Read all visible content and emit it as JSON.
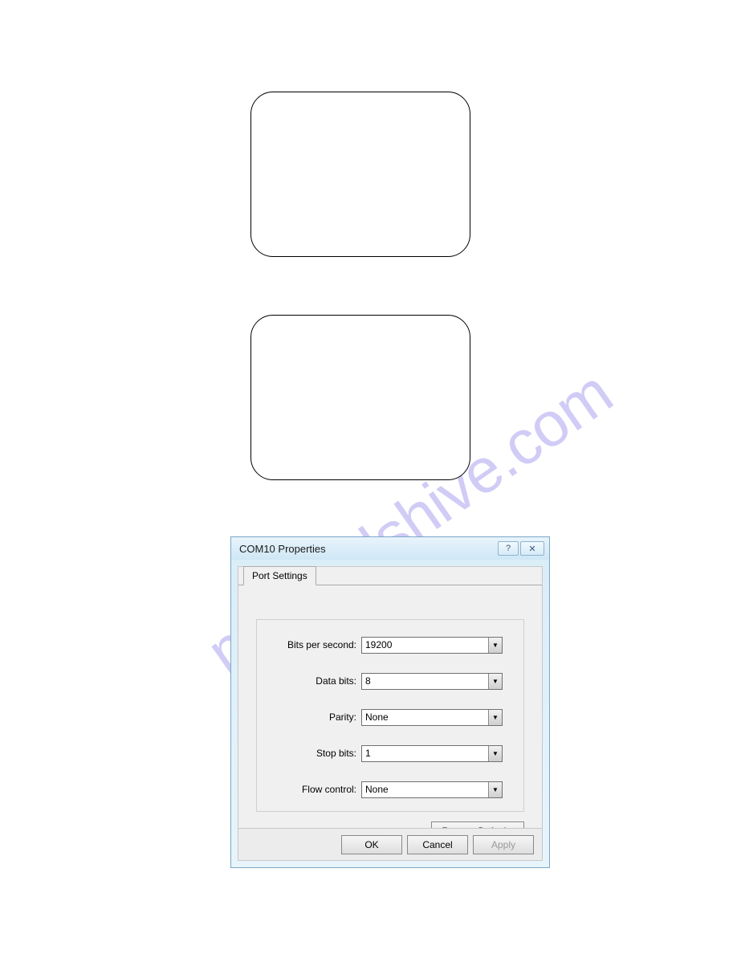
{
  "watermark": "manualshive.com",
  "dialog": {
    "title": "COM10 Properties",
    "tab_label": "Port Settings",
    "fields": {
      "bits_per_second": {
        "label": "Bits per second:",
        "value": "19200"
      },
      "data_bits": {
        "label": "Data bits:",
        "value": "8"
      },
      "parity": {
        "label": "Parity:",
        "value": "None"
      },
      "stop_bits": {
        "label": "Stop bits:",
        "value": "1"
      },
      "flow_control": {
        "label": "Flow control:",
        "value": "None"
      }
    },
    "restore_label": "Restore Defaults",
    "buttons": {
      "ok": "OK",
      "cancel": "Cancel",
      "apply": "Apply"
    }
  }
}
